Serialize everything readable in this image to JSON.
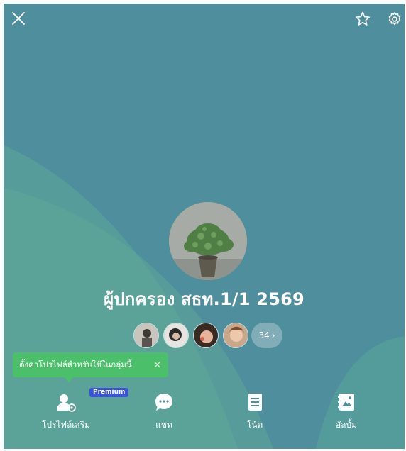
{
  "header": {
    "close_icon": "close-icon",
    "favorite_icon": "star-icon",
    "settings_icon": "gear-icon"
  },
  "profile": {
    "group_name": "ผู้ปกครอง สธท.1/1 2569",
    "member_more_count": "34",
    "members": [
      "member-avatar-1",
      "member-avatar-2",
      "member-avatar-3",
      "member-avatar-4"
    ]
  },
  "tooltip": {
    "text": "ตั้งค่าโปรไฟล์สำหรับใช้ในกลุ่มนี้",
    "close_label": "×"
  },
  "actions": [
    {
      "label": "โปรไฟล์เสริม",
      "icon": "profile-settings-icon",
      "badge": "Premium"
    },
    {
      "label": "แชท",
      "icon": "chat-icon"
    },
    {
      "label": "โน้ต",
      "icon": "note-icon"
    },
    {
      "label": "อัลบั้ม",
      "icon": "album-icon"
    }
  ],
  "colors": {
    "background": "#4f8e9c",
    "tooltip": "#4cbf6a",
    "badge": "#3a54d6"
  }
}
